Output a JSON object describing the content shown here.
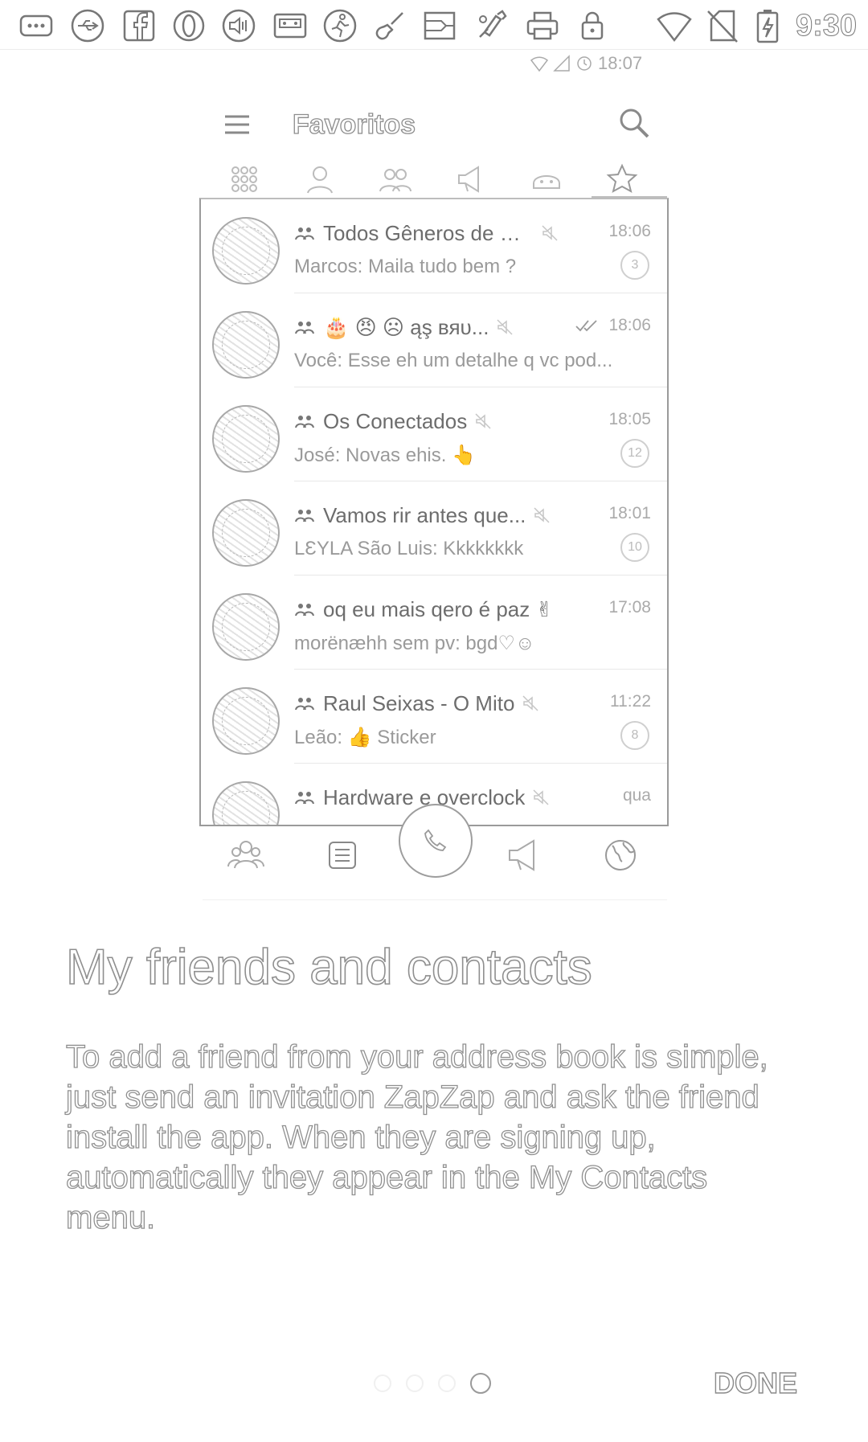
{
  "status_bar": {
    "time": "9:30",
    "notification_icons": [
      "more-horizontal-icon",
      "usb-icon",
      "facebook-icon",
      "opera-icon",
      "volume-icon",
      "cassette-icon",
      "runner-icon",
      "guitar-icon",
      "sim-icon",
      "paint-icon",
      "printer-icon",
      "lock-icon"
    ],
    "system_icons": [
      "wifi-icon",
      "no-sim-icon",
      "battery-charging-icon"
    ]
  },
  "mockup": {
    "status_time": "18:07",
    "toolbar_title": "Favoritos",
    "tabs": [
      "grid-icon",
      "person-icon",
      "people-icon",
      "megaphone-icon",
      "mask-icon",
      "star-icon"
    ],
    "active_tab": "star-icon",
    "chats": [
      {
        "name": "Todos Gêneros de M...",
        "time": "18:06",
        "preview": "Marcos: Maila tudo bem ?",
        "unread": "3",
        "read_receipt": false
      },
      {
        "name": "🎂 😠 ☹ ąş вяυ...",
        "time": "18:06",
        "preview": "Você: Esse eh um detalhe q vc pod...",
        "unread": "",
        "read_receipt": true
      },
      {
        "name": "Os Conectados",
        "time": "18:05",
        "preview": "José: Novas ehis. 👆",
        "unread": "12",
        "read_receipt": false
      },
      {
        "name": "Vamos rir antes que...",
        "time": "18:01",
        "preview": "LƐYLA São Luis: Kkkkkkkk",
        "unread": "10",
        "read_receipt": false
      },
      {
        "name": "oq eu mais qero é paz ✌",
        "time": "17:08",
        "preview": "morënæhh sem pv: bgd♡☺",
        "unread": "",
        "read_receipt": false
      },
      {
        "name": "Raul Seixas - O Mito",
        "time": "11:22",
        "preview": "Leão: 👍 Sticker",
        "unread": "8",
        "read_receipt": false
      },
      {
        "name": "Hardware e overclock",
        "time": "qua",
        "preview": "",
        "unread": "",
        "read_receipt": false
      }
    ],
    "bottom_nav": [
      "groups-icon",
      "list-icon",
      "phone-icon",
      "megaphone-icon",
      "globe-icon"
    ]
  },
  "onboarding": {
    "title": "My friends and contacts",
    "body": "To add a friend from your address book is simple, just send an invitation ZapZap and ask the friend install the app. When they are signing up, automatically they appear in the My Contacts menu.",
    "page_count": 4,
    "active_page": 4,
    "done_label": "DONE"
  }
}
